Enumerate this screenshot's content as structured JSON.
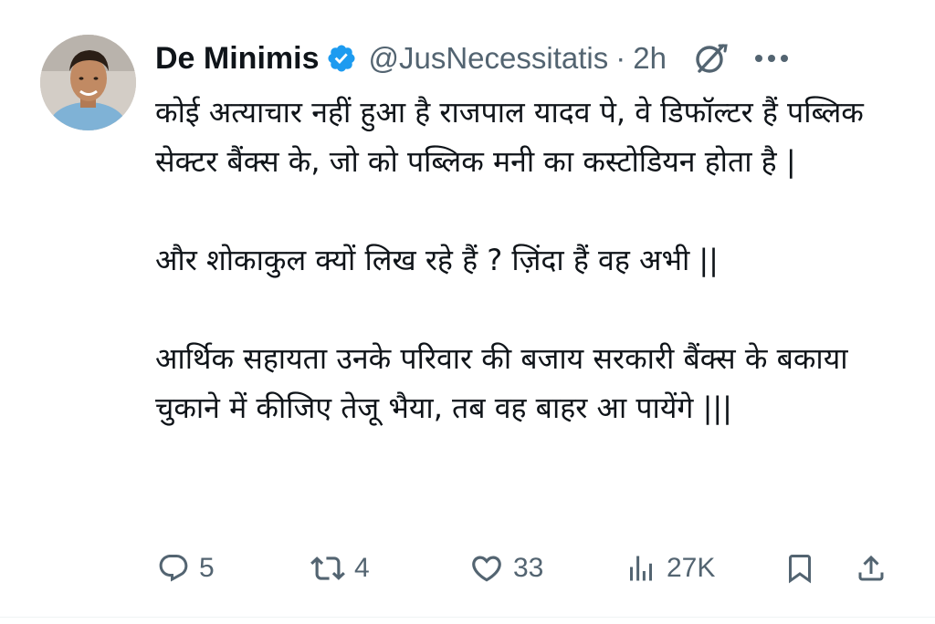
{
  "author": {
    "name": "De Minimis",
    "handle": "@JusNecessitatis",
    "separator": "·",
    "time": "2h",
    "verified": true,
    "verified_color": "#1d9bf0"
  },
  "tweet": {
    "paragraphs": [
      "कोई अत्याचार नहीं हुआ है राजपाल यादव पे, वे डिफॉल्टर हैं पब्लिक सेक्टर बैंक्स के, जो को पब्लिक मनी का कस्टोडियन होता है |",
      "और शोकाकुल क्यों लिख रहे हैं ? ज़िंदा हैं वह अभी ||",
      "आर्थिक सहायता उनके परिवार की बजाय सरकारी बैंक्स के बकाया चुकाने में कीजिए तेजू भैया, तब वह बाहर आ पायेंगे |||"
    ]
  },
  "actions": {
    "reply": {
      "icon": "reply-icon",
      "count": "5"
    },
    "repost": {
      "icon": "repost-icon",
      "count": "4"
    },
    "like": {
      "icon": "heart-icon",
      "count": "33"
    },
    "views": {
      "icon": "views-icon",
      "count": "27K"
    },
    "bookmark": {
      "icon": "bookmark-icon"
    },
    "share": {
      "icon": "share-icon"
    }
  },
  "colors": {
    "text": "#0f1419",
    "secondary": "#536471",
    "accent": "#1d9bf0"
  }
}
